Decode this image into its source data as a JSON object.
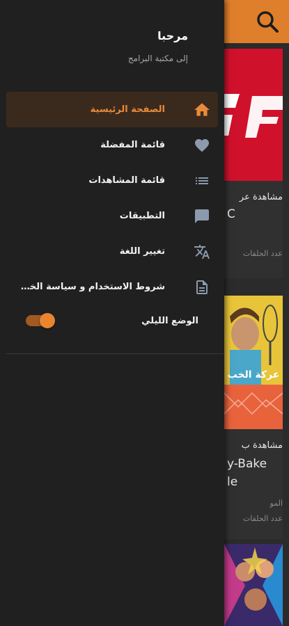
{
  "drawer": {
    "title": "مرحبا",
    "subtitle": "إلى مكتبة البرامج",
    "menu": [
      {
        "label": "الصفحة الرئيسية",
        "icon": "home-icon",
        "active": true
      },
      {
        "label": "قائمة المفضلة",
        "icon": "heart-icon",
        "active": false
      },
      {
        "label": "قائمة المشاهدات",
        "icon": "list-icon",
        "active": false
      },
      {
        "label": "التطبيقات",
        "icon": "chat-bubble-icon",
        "active": false
      },
      {
        "label": "تغيير اللغة",
        "icon": "translate-icon",
        "active": false
      },
      {
        "label": "شروط الاستخدام و سياسة الخصو...",
        "icon": "document-icon",
        "active": false
      }
    ],
    "night_mode": {
      "label": "الوضع الليلي",
      "enabled": true
    }
  },
  "background": {
    "card1": {
      "line1": "مشاهدة عر",
      "line2": "C",
      "line3": "عدد الحلقات"
    },
    "card2": {
      "line1": "مشاهدة ب",
      "line2": "y-Bake",
      "line3": "le",
      "line4": "المو",
      "line5": "عدد الحلقات"
    }
  },
  "colors": {
    "accent": "#e98a3a",
    "drawer_bg": "#202020",
    "active_bg": "#3a2a1d"
  }
}
